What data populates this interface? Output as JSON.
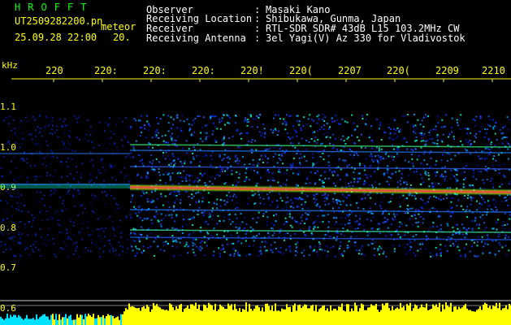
{
  "app": {
    "name": "HROFFT"
  },
  "file": {
    "name": "UT2509282200.pn",
    "tag": "meteor",
    "datetime": "25.09.28 22:00",
    "frag": "20."
  },
  "info": [
    {
      "label": "Observer",
      "sep": ":",
      "value": "Masaki Kano"
    },
    {
      "label": "Receiving Location",
      "sep": ":",
      "value": "Shibukawa, Gunma, Japan"
    },
    {
      "label": "Receiver",
      "sep": ":",
      "value": "RTL-SDR SDR# 43dB L15 103.2MHz CW"
    },
    {
      "label": "Receiving Antenna",
      "sep": ":",
      "value": "3el Yagi(V) Az 330 for Vladivostok"
    }
  ],
  "axis": {
    "unit": "kHz",
    "time_ticks": [
      "220",
      "220:",
      "220:",
      "220:",
      "220!",
      "220(",
      "2207",
      "220(",
      "2209",
      "2210"
    ],
    "freq_ticks": [
      "1.1",
      "1.0",
      "0.9",
      "0.8",
      "0.7",
      "0.6"
    ]
  },
  "colors": {
    "text_accent": "#ffff00",
    "app_name": "#00ff00",
    "signal": "#ff2060",
    "noise": "#0a2aff",
    "level": "#ffff00",
    "level_low": "#00e0ff"
  }
}
